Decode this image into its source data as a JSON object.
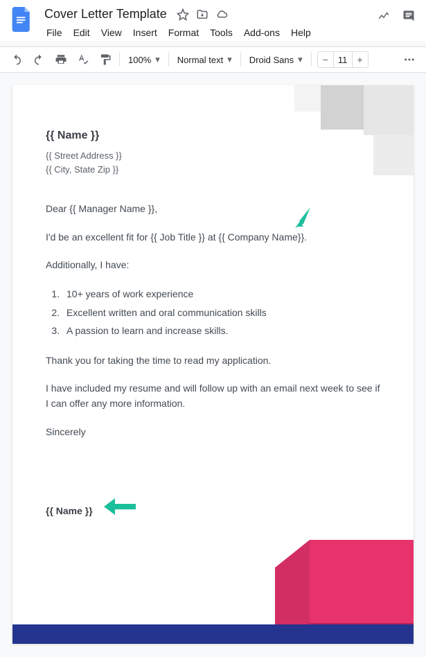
{
  "header": {
    "title": "Cover Letter Template",
    "menus": {
      "file": "File",
      "edit": "Edit",
      "view": "View",
      "insert": "Insert",
      "format": "Format",
      "tools": "Tools",
      "addons": "Add-ons",
      "help": "Help"
    }
  },
  "toolbar": {
    "zoom": "100%",
    "style": "Normal text",
    "font": "Droid Sans",
    "font_size": "11"
  },
  "doc": {
    "name_placeholder": "{{ Name }}",
    "street": "{{ Street Address }}",
    "city": "{{ City, State Zip }}",
    "greeting": "Dear {{ Manager Name }},",
    "intro": "I'd be an excellent fit for {{ Job Title }} at {{ Company Name}}.",
    "additionally": "Additionally, I have:",
    "bullets": {
      "b1": "10+ years of work experience",
      "b2": "Excellent written and oral communication skills",
      "b3": "A passion to learn and increase skills."
    },
    "thanks": "Thank you for taking the time to read my application.",
    "followup": "I have included my resume and will follow up with an email next week to see if I can offer any more information.",
    "closing": "Sincerely",
    "sig_name": "{{ Name }}"
  }
}
